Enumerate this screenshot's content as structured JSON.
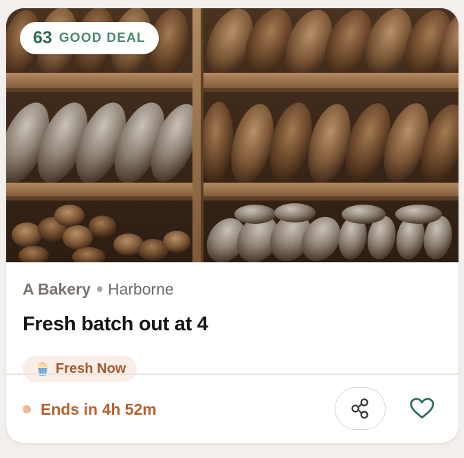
{
  "deal": {
    "score": "63",
    "score_label": "GOOD DEAL",
    "vendor": "A Bakery",
    "location": "Harborne",
    "title": "Fresh batch out at 4",
    "tag": {
      "icon": "cupcake-icon",
      "label": "Fresh Now"
    },
    "ends": "Ends in 4h 52m"
  },
  "image": {
    "alt": "bread-loaves-on-shelves"
  },
  "actions": {
    "share_icon": "share-icon",
    "favorite_icon": "heart-icon"
  },
  "colors": {
    "score_green": "#2f6b4f",
    "accent_orange": "#b8612f",
    "tag_bg": "#fbeee6",
    "heart_green": "#2f6b4f"
  }
}
